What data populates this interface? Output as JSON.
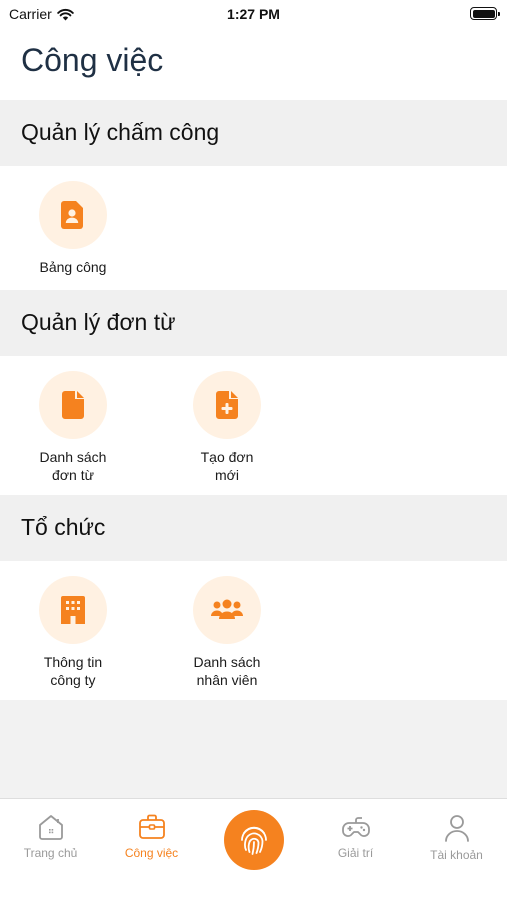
{
  "status_bar": {
    "carrier": "Carrier",
    "time": "1:27 PM"
  },
  "header": {
    "title": "Công việc"
  },
  "sections": [
    {
      "title": "Quản lý chấm công",
      "items": [
        {
          "label": "Bảng công",
          "icon": "contact-card-icon"
        }
      ]
    },
    {
      "title": "Quản lý đơn từ",
      "items": [
        {
          "label": "Danh sách\nđơn từ",
          "icon": "document-icon"
        },
        {
          "label": "Tạo đơn\nmới",
          "icon": "document-add-icon"
        }
      ]
    },
    {
      "title": "Tổ chức",
      "items": [
        {
          "label": "Thông tin\ncông ty",
          "icon": "building-icon"
        },
        {
          "label": "Danh sách\nnhân viên",
          "icon": "users-icon"
        }
      ]
    }
  ],
  "tabbar": {
    "items": [
      {
        "label": "Trang chủ",
        "icon": "home-icon",
        "active": false
      },
      {
        "label": "Công việc",
        "icon": "briefcase-icon",
        "active": true
      },
      {
        "label": "",
        "icon": "fingerprint-icon",
        "active": false
      },
      {
        "label": "Giải trí",
        "icon": "gamepad-icon",
        "active": false
      },
      {
        "label": "Tài khoản",
        "icon": "user-icon",
        "active": false
      }
    ]
  },
  "colors": {
    "accent": "#f5821f",
    "icon_bg": "#fff1e2",
    "section_bg": "#f0f0f0",
    "inactive": "#9a9a9a"
  }
}
